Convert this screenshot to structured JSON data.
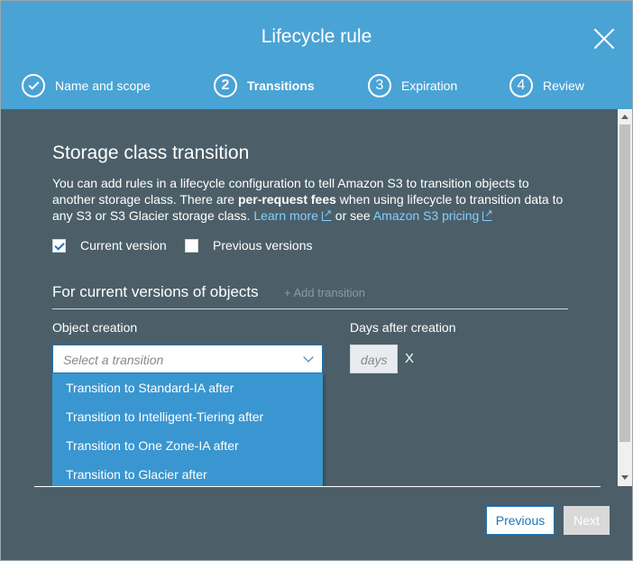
{
  "dialog": {
    "title": "Lifecycle rule"
  },
  "steps": [
    {
      "number": "",
      "label": "Name and scope",
      "state": "completed"
    },
    {
      "number": "2",
      "label": "Transitions",
      "state": "active"
    },
    {
      "number": "3",
      "label": "Expiration",
      "state": "pending"
    },
    {
      "number": "4",
      "label": "Review",
      "state": "pending"
    }
  ],
  "section": {
    "title": "Storage class transition",
    "desc_part1": "You can add rules in a lifecycle configuration to tell Amazon S3 to transition objects to another storage class. There are ",
    "desc_bold": "per-request fees",
    "desc_part2": " when using lifecycle to transition data to any S3 or S3 Glacier storage class. ",
    "learn_more": "Learn more",
    "or_see": " or see ",
    "pricing_link": "Amazon S3 pricing"
  },
  "versions": {
    "current": {
      "label": "Current version",
      "checked": true
    },
    "previous": {
      "label": "Previous versions",
      "checked": false
    }
  },
  "current_versions": {
    "title": "For current versions of objects",
    "add_transition": "+ Add transition",
    "object_creation_label": "Object creation",
    "days_label": "Days after creation",
    "select_placeholder": "Select a transition",
    "days_placeholder": "days",
    "remove": "X",
    "options": [
      "Transition to Standard-IA after",
      "Transition to Intelligent-Tiering after",
      "Transition to One Zone-IA after",
      "Transition to Glacier after"
    ]
  },
  "footer": {
    "previous": "Previous",
    "next": "Next"
  },
  "colors": {
    "header": "#4aa3d5",
    "body": "#4c5f69",
    "link": "#7fd1ff",
    "dropdown": "#3a96d0",
    "accent": "#1c75b8"
  }
}
